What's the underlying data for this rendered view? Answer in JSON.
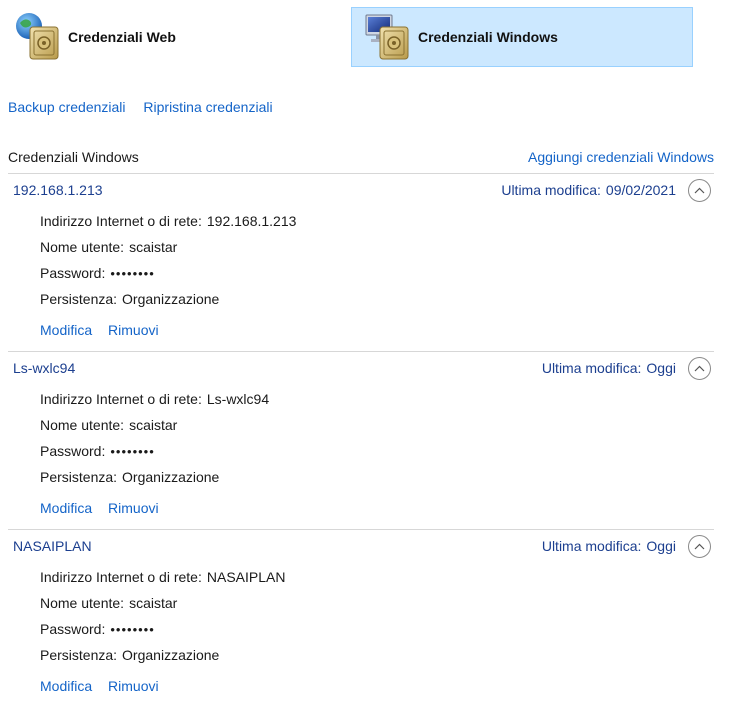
{
  "tabs": [
    {
      "label": "Credenziali Web",
      "icon": "globe-vault-icon"
    },
    {
      "label": "Credenziali Windows",
      "icon": "monitor-vault-icon"
    }
  ],
  "actions": {
    "backup": "Backup credenziali",
    "restore": "Ripristina credenziali"
  },
  "section": {
    "title": "Credenziali Windows",
    "add": "Aggiungi credenziali Windows"
  },
  "labels": {
    "last_modified": "Ultima modifica:",
    "address": "Indirizzo Internet o di rete:",
    "username": "Nome utente:",
    "password": "Password:",
    "persistence": "Persistenza:",
    "edit": "Modifica",
    "remove": "Rimuovi"
  },
  "credentials": [
    {
      "name": "192.168.1.213",
      "date": "09/02/2021",
      "address": "192.168.1.213",
      "username": "scaistar",
      "password": "••••••••",
      "persistence": "Organizzazione"
    },
    {
      "name": "Ls-wxlc94",
      "date": "Oggi",
      "address": "Ls-wxlc94",
      "username": "scaistar",
      "password": "••••••••",
      "persistence": "Organizzazione"
    },
    {
      "name": "NASAIPLAN",
      "date": "Oggi",
      "address": "NASAIPLAN",
      "username": "scaistar",
      "password": "••••••••",
      "persistence": "Organizzazione"
    }
  ],
  "colors": {
    "link": "#1464c8",
    "navy": "#1c3f8f",
    "selected_bg": "#cce8ff",
    "selected_border": "#99d1ff"
  }
}
